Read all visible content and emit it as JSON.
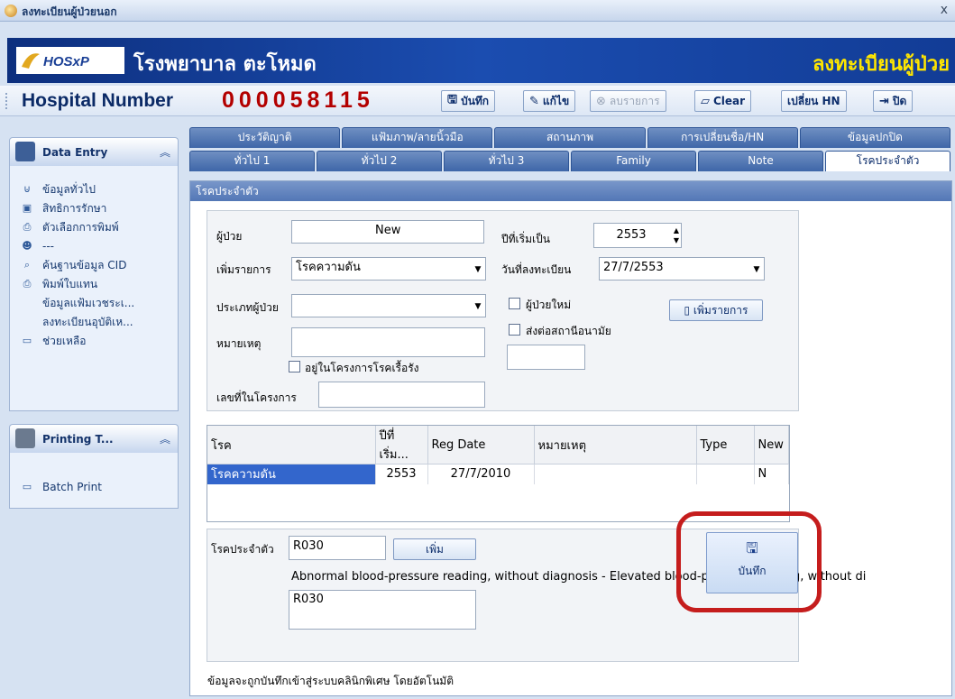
{
  "window": {
    "title": "ลงทะเบียนผู้ป่วยนอก",
    "close": "x"
  },
  "header": {
    "hospital_name": "โรงพยาบาล ตะโหมด",
    "page_title": "ลงทะเบียนผู้ป่วย",
    "logo_text": "HOSxP"
  },
  "hn_bar": {
    "label": "Hospital Number",
    "number": "000058115",
    "buttons": {
      "save": "บันทึก",
      "edit": "แก้ไข",
      "delete": "ลบรายการ",
      "clear": "Clear",
      "change_hn": "เปลี่ยน HN",
      "close": "ปิด"
    }
  },
  "sidebar": {
    "data_entry": {
      "title": "Data Entry",
      "items": [
        {
          "label": "ข้อมูลทั่วไป",
          "icon": "info-icon"
        },
        {
          "label": "สิทธิการรักษา",
          "icon": "shield-icon"
        },
        {
          "label": "ตัวเลือกการพิมพ์",
          "icon": "printer-icon"
        },
        {
          "label": "---",
          "icon": "people-icon"
        },
        {
          "label": "ค้นฐานข้อมูล CID",
          "icon": "search-db-icon"
        },
        {
          "label": "พิมพ์ใบแทน",
          "icon": "printer-icon"
        },
        {
          "label": "ข้อมูลแฟ้มเวชระเ...",
          "icon": ""
        },
        {
          "label": "ลงทะเบียนอุบัติเห...",
          "icon": ""
        },
        {
          "label": "ช่วยเหลือ",
          "icon": "help-icon"
        }
      ]
    },
    "printing": {
      "title": "Printing T...",
      "items": [
        {
          "label": "Batch Print",
          "icon": "batch-icon"
        }
      ]
    }
  },
  "tabs": {
    "row1": [
      "ประวัติญาติ",
      "แฟ้มภาพ/ลายนิ้วมือ",
      "สถานภาพ",
      "การเปลี่ยนชื่อ/HN",
      "ข้อมูลปกปิด"
    ],
    "row2": [
      "ทั่วไป 1",
      "ทั่วไป 2",
      "ทั่วไป 3",
      "Family",
      "Note",
      "โรคประจำตัว"
    ],
    "selected": "โรคประจำตัว"
  },
  "section": {
    "title": "โรคประจำตัว"
  },
  "form": {
    "patient_label": "ผู้ป่วย",
    "patient_value": "New",
    "start_year_label": "ปีที่เริ่มเป็น",
    "start_year_value": "2553",
    "add_item_label": "เพิ่มรายการ",
    "add_item_value": "โรคความดัน",
    "reg_date_label": "วันที่ลงทะเบียน",
    "reg_date_value": "27/7/2553",
    "patient_type_label": "ประเภทผู้ป่วย",
    "patient_type_value": "",
    "new_patient_label": "ผู้ป่วยใหม่",
    "refer_label": "ส่งต่อสถานีอนามัย",
    "add_button": "เพิ่มรายการ",
    "note_label": "หมายเหตุ",
    "note_value": "",
    "chronic_program_label": "อยู่ในโครงการโรคเรื้อรัง",
    "program_no_label": "เลขที่ในโครงการ",
    "program_no_value": ""
  },
  "grid": {
    "columns": [
      "โรค",
      "ปีที่เริ่ม...",
      "Reg Date",
      "หมายเหตุ",
      "Type",
      "New"
    ],
    "rows": [
      [
        "โรคความดัน",
        "2553",
        "27/7/2010",
        "",
        "",
        "N"
      ]
    ]
  },
  "icd": {
    "label": "โรคประจำตัว",
    "code": "R030",
    "add_button": "เพิ่ม",
    "description": "Abnormal blood-pressure reading, without diagnosis - Elevated blood-pressure reading, without di",
    "list_value": "R030",
    "save_button": "บันทึก"
  },
  "footer_note": "ข้อมูลจะถูกบันทึกเข้าสู่ระบบคลินิกพิเศษ โดยอัตโนมัติ",
  "colors": {
    "brand_blue": "#1b4db0",
    "title_yellow": "#ffe600",
    "hn_red": "#b30000",
    "highlight_red": "#c51d1d"
  }
}
